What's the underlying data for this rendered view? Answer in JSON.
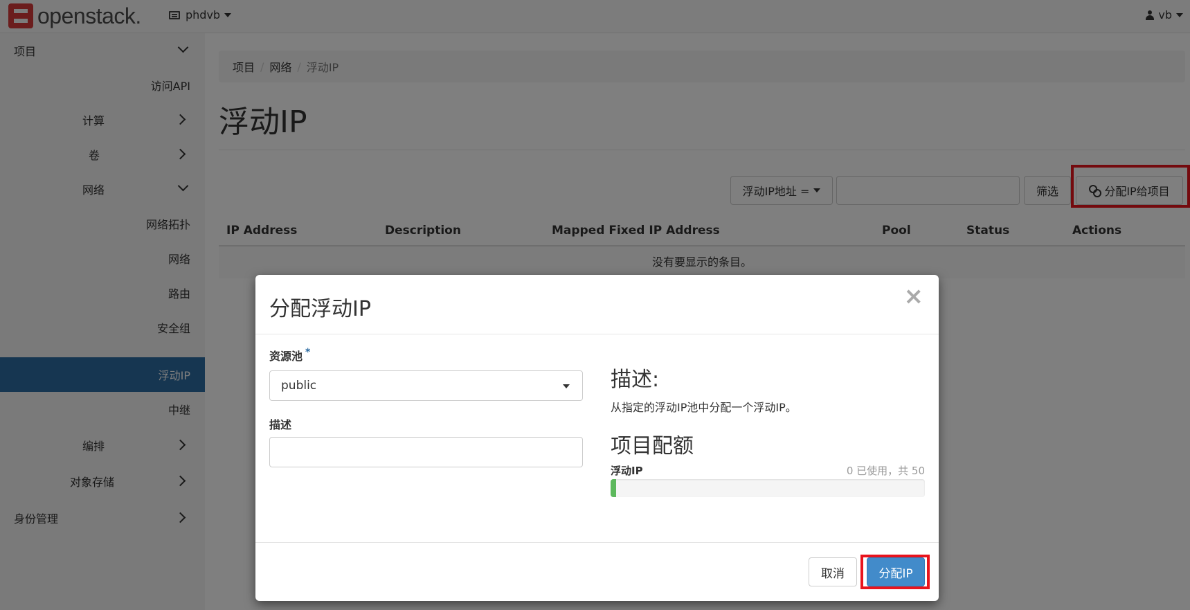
{
  "navbar": {
    "brand": "openstack.",
    "project": "phdvb",
    "user": "vb"
  },
  "sidebar": {
    "items": [
      {
        "label": "项目",
        "chevron": "down"
      },
      {
        "label": "访问API",
        "chevron": ""
      },
      {
        "label": "计算",
        "chevron": "right"
      },
      {
        "label": "卷",
        "chevron": "right"
      },
      {
        "label": "网络",
        "chevron": "down"
      },
      {
        "label": "网络拓扑",
        "chevron": ""
      },
      {
        "label": "网络",
        "chevron": ""
      },
      {
        "label": "路由",
        "chevron": ""
      },
      {
        "label": "安全组",
        "chevron": ""
      },
      {
        "label": "浮动IP",
        "chevron": "",
        "active": true
      },
      {
        "label": "中继",
        "chevron": ""
      },
      {
        "label": "编排",
        "chevron": "right"
      },
      {
        "label": "对象存储",
        "chevron": "right"
      },
      {
        "label": "身份管理",
        "chevron": "right"
      }
    ]
  },
  "breadcrumb": {
    "items": [
      "项目",
      "网络",
      "浮动IP"
    ],
    "separator": "/"
  },
  "page": {
    "title": "浮动IP"
  },
  "filter": {
    "field_label": "浮动IP地址 =",
    "input_value": "",
    "filter_button": "筛选",
    "allocate_button": "分配IP给项目"
  },
  "table": {
    "columns": [
      "IP Address",
      "Description",
      "Mapped Fixed IP Address",
      "Pool",
      "Status",
      "Actions"
    ],
    "empty_message": "没有要显示的条目。"
  },
  "modal": {
    "title": "分配浮动IP",
    "close_symbol": "×",
    "pool_label": "资源池",
    "required_mark": "*",
    "pool_value": "public",
    "description_label": "描述",
    "description_value": "",
    "help_heading": "描述:",
    "help_text": "从指定的浮动IP池中分配一个浮动IP。",
    "quota_heading": "项目配额",
    "quota_label": "浮动IP",
    "quota_usage": "0 已使用，共 50",
    "quota_used": 0,
    "quota_total": 50,
    "cancel_button": "取消",
    "submit_button": "分配IP"
  },
  "colors": {
    "active_nav": "#2d6ca2",
    "primary_button": "#428bca",
    "progress_fill": "#5cb85c",
    "highlight_box": "#e8141d"
  }
}
